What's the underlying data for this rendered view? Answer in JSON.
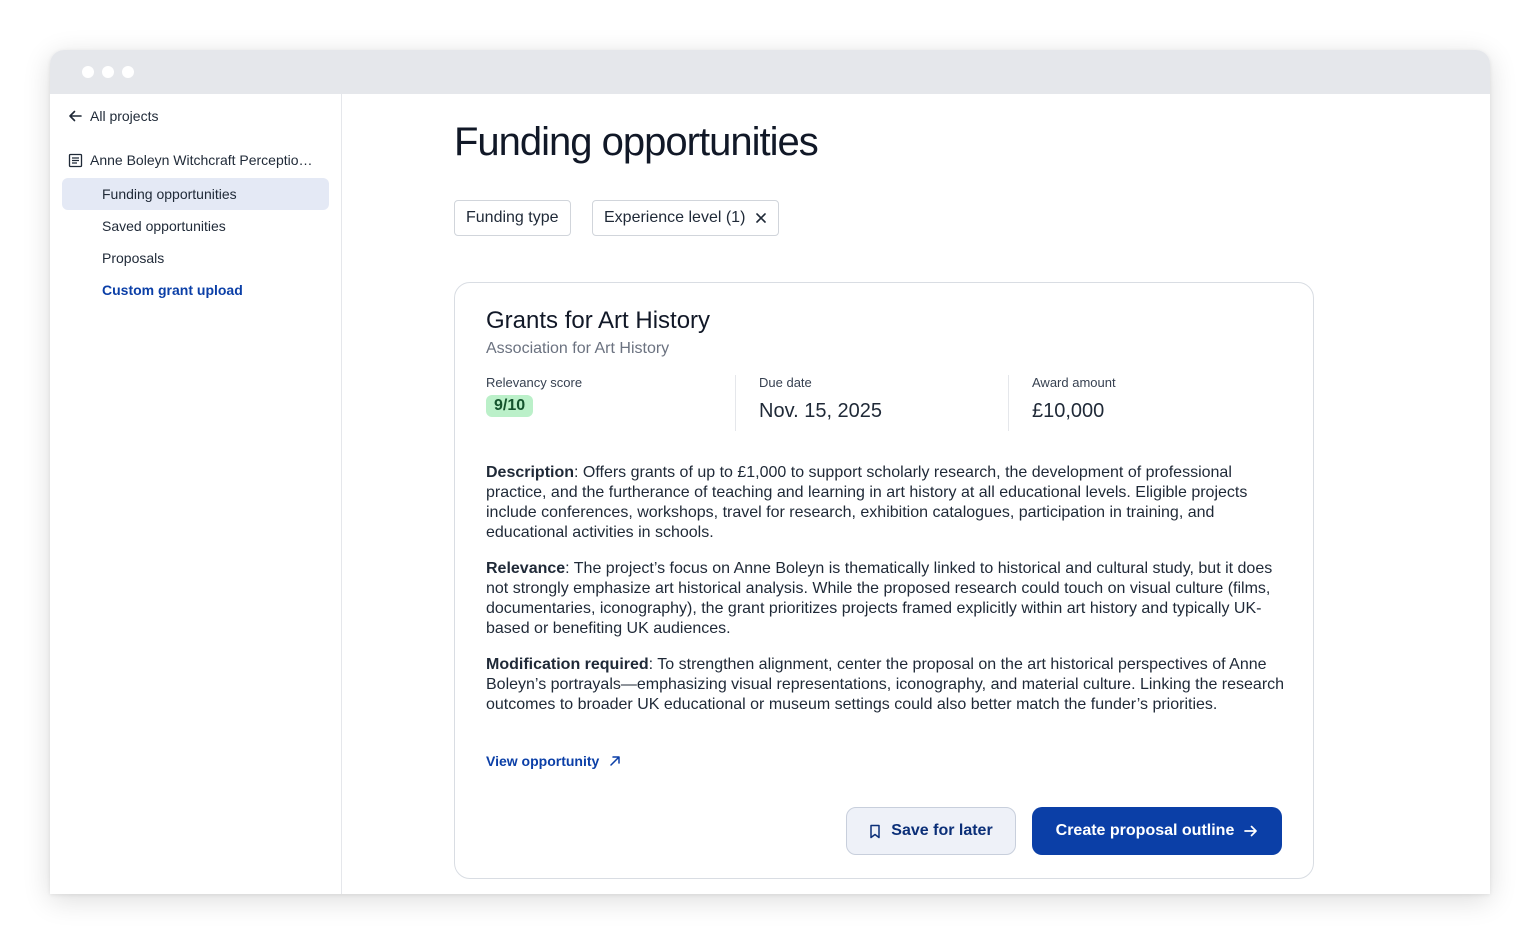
{
  "sidebar": {
    "back_label": "All projects",
    "project_name": "Anne Boleyn Witchcraft Perceptio…",
    "items": [
      {
        "label": "Funding opportunities"
      },
      {
        "label": "Saved opportunities"
      },
      {
        "label": "Proposals"
      },
      {
        "label": "Custom grant upload"
      }
    ]
  },
  "main": {
    "title": "Funding opportunities",
    "filters": [
      {
        "label": "Funding type"
      },
      {
        "label": "Experience level (1)"
      }
    ],
    "card": {
      "title": "Grants for Art History",
      "organization": "Association for Art History",
      "relevancy_label": "Relevancy score",
      "relevancy_value": "9/10",
      "due_label": "Due date",
      "due_value": "Nov. 15, 2025",
      "award_label": "Award amount",
      "award_value": "£10,000",
      "description_label": "Description",
      "description_text": ": Offers grants of up to £1,000 to support scholarly research, the development of professional practice, and the furtherance of teaching and learning in art history at all educational levels. Eligible projects include conferences, workshops, travel for research, exhibition catalogues, participation in training, and educational activities in schools.",
      "relevance_label": "Relevance",
      "relevance_text": ": The project’s focus on Anne Boleyn is thematically linked to historical and cultural study, but it does not strongly emphasize art historical analysis. While the proposed research could touch on visual culture (films, documentaries, iconography), the grant prioritizes projects framed explicitly within art history and typically UK-based or benefiting UK audiences.",
      "modification_label": "Modification required",
      "modification_text": ": To strengthen alignment, center the proposal on the art historical perspectives of Anne Boleyn’s portrayals—emphasizing visual representations, iconography, and material culture. Linking the research outcomes to broader UK educational or museum settings could also better match the funder’s priorities.",
      "view_link": "View opportunity",
      "save_label": "Save for later",
      "create_label": "Create proposal outline"
    }
  },
  "colors": {
    "accent": "#0b3fa7",
    "active_nav_bg": "#e4e9f5",
    "score_badge_bg": "#bbf0c9"
  },
  "icons": [
    "arrow-left-icon",
    "document-icon",
    "close-icon",
    "external-link-icon",
    "bookmark-icon",
    "arrow-right-icon"
  ]
}
